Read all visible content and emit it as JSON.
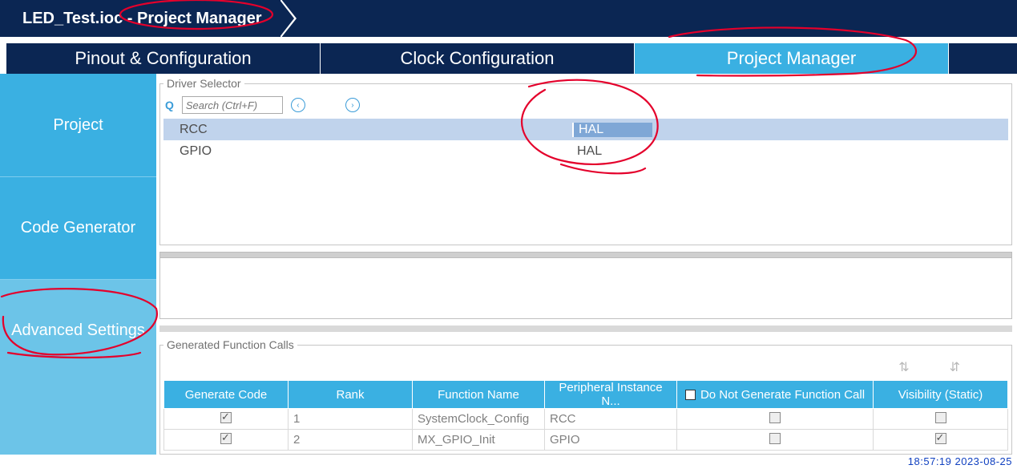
{
  "breadcrumb": {
    "title": "LED_Test.ioc - Project Manager"
  },
  "topTabs": [
    {
      "label": "Pinout & Configuration",
      "active": false
    },
    {
      "label": "Clock Configuration",
      "active": false
    },
    {
      "label": "Project Manager",
      "active": true
    }
  ],
  "sidebar": {
    "items": [
      {
        "label": "Project",
        "active": false
      },
      {
        "label": "Code Generator",
        "active": false
      },
      {
        "label": "Advanced Settings",
        "active": true
      }
    ]
  },
  "driverSelector": {
    "legend": "Driver Selector",
    "searchPlaceholder": "Search (Ctrl+F)",
    "rows": [
      {
        "name": "RCC",
        "value": "HAL",
        "selected": true
      },
      {
        "name": "GPIO",
        "value": "HAL",
        "selected": false
      }
    ]
  },
  "generatedCalls": {
    "legend": "Generated Function Calls",
    "headers": {
      "gen": "Generate Code",
      "rank": "Rank",
      "func": "Function Name",
      "periph": "Peripheral Instance N...",
      "noGen": "Do Not Generate Function Call",
      "vis": "Visibility (Static)"
    },
    "rows": [
      {
        "gen": true,
        "rank": "1",
        "func": "SystemClock_Config",
        "periph": "RCC",
        "noGen": false,
        "vis": false
      },
      {
        "gen": true,
        "rank": "2",
        "func": "MX_GPIO_Init",
        "periph": "GPIO",
        "noGen": false,
        "vis": true
      }
    ]
  },
  "timestamp": "18:57:19 2023-08-25"
}
